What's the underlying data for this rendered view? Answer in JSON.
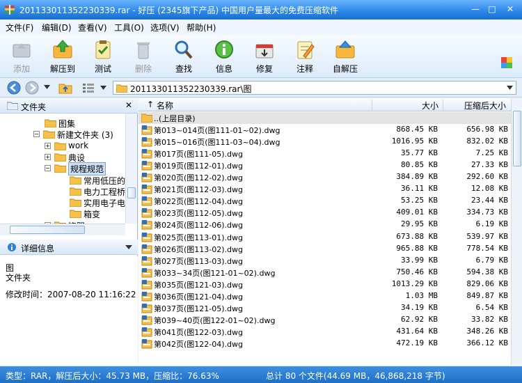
{
  "window": {
    "title": "201133011352230339.rar - 好压 (2345旗下产品) 中国用户量最大的免费压缩软件",
    "min": "—",
    "max": "□",
    "close": "✕"
  },
  "menu": [
    "文件(F)",
    "编辑(D)",
    "查看(V)",
    "工具(O)",
    "选项(V)",
    "帮助(H)"
  ],
  "toolbar": [
    {
      "label": "添加",
      "icon": "add-icon",
      "enabled": false
    },
    {
      "label": "解压到",
      "icon": "extract-icon",
      "enabled": true
    },
    {
      "label": "测试",
      "icon": "test-icon",
      "enabled": true
    },
    {
      "label": "删除",
      "icon": "delete-icon",
      "enabled": false
    },
    {
      "label": "查找",
      "icon": "find-icon",
      "enabled": true
    },
    {
      "label": "信息",
      "icon": "info-icon",
      "enabled": true
    },
    {
      "label": "修复",
      "icon": "repair-icon",
      "enabled": true
    },
    {
      "label": "注释",
      "icon": "comment-icon",
      "enabled": true
    },
    {
      "label": "自解压",
      "icon": "sfx-icon",
      "enabled": true
    }
  ],
  "address": {
    "path": "201133011352230339.rar\\图"
  },
  "folder_pane": {
    "title": "文件夹",
    "close": "✕",
    "tree": [
      {
        "label": "图集",
        "level": 2,
        "expander": ""
      },
      {
        "label": "新建文件夹 (3)",
        "level": 1,
        "expander": "−"
      },
      {
        "label": "work",
        "level": 2,
        "expander": "+"
      },
      {
        "label": "典设",
        "level": 2,
        "expander": "+"
      },
      {
        "label": "规程规范",
        "level": 2,
        "expander": "−",
        "selected": true
      },
      {
        "label": "常用低压的",
        "level": 3,
        "expander": ""
      },
      {
        "label": "电力工程桥",
        "level": 3,
        "expander": ""
      },
      {
        "label": "实用电子电",
        "level": 3,
        "expander": ""
      },
      {
        "label": "箱变",
        "level": 3,
        "expander": ""
      },
      {
        "label": "饶阳",
        "level": 2,
        "expander": "+"
      }
    ]
  },
  "details_pane": {
    "title": "详细信息",
    "name": "图",
    "type": "文件夹",
    "modified": "修改时间：2007-08-20 11:16:22"
  },
  "columns": {
    "name": "名称",
    "size": "大小",
    "csize": "压缩后大小"
  },
  "files": [
    {
      "name": "..(上层目录)",
      "size": "",
      "csize": "",
      "parent": true
    },
    {
      "name": "第013~014页(图111-01~02).dwg",
      "size": "868.45 KB",
      "csize": "656.98 KB"
    },
    {
      "name": "第015~016页(图111-03~04).dwg",
      "size": "1016.95 KB",
      "csize": "832.02 KB"
    },
    {
      "name": "第017页(图111-05).dwg",
      "size": "35.77 KB",
      "csize": "7.25 KB"
    },
    {
      "name": "第019页(图112-01).dwg",
      "size": "80.85 KB",
      "csize": "27.33 KB"
    },
    {
      "name": "第020页(图112-02).dwg",
      "size": "384.89 KB",
      "csize": "292.60 KB"
    },
    {
      "name": "第021页(图112-03).dwg",
      "size": "36.11 KB",
      "csize": "12.08 KB"
    },
    {
      "name": "第022页(图112-04).dwg",
      "size": "53.25 KB",
      "csize": "23.44 KB"
    },
    {
      "name": "第023页(图112-05).dwg",
      "size": "409.01 KB",
      "csize": "334.73 KB"
    },
    {
      "name": "第024页(图112-06).dwg",
      "size": "29.95 KB",
      "csize": "6.19 KB"
    },
    {
      "name": "第025页(图113-01).dwg",
      "size": "673.88 KB",
      "csize": "539.97 KB"
    },
    {
      "name": "第026页(图113-02).dwg",
      "size": "965.88 KB",
      "csize": "778.54 KB"
    },
    {
      "name": "第027页(图113-03).dwg",
      "size": "33.99 KB",
      "csize": "6.79 KB"
    },
    {
      "name": "第033~34页(图121-01~02).dwg",
      "size": "750.46 KB",
      "csize": "594.38 KB"
    },
    {
      "name": "第035页(图121-03).dwg",
      "size": "1013.29 KB",
      "csize": "829.06 KB"
    },
    {
      "name": "第036页(图121-04).dwg",
      "size": "1.03 MB",
      "csize": "849.87 KB"
    },
    {
      "name": "第037页(图121-05).dwg",
      "size": "34.19 KB",
      "csize": "6.54 KB"
    },
    {
      "name": "第039~40页(图122-01~02).dwg",
      "size": "62.92 KB",
      "csize": "33.82 KB"
    },
    {
      "name": "第041页(图122-03).dwg",
      "size": "431.64 KB",
      "csize": "348.26 KB"
    },
    {
      "name": "第042页(图122-04).dwg",
      "size": "472.19 KB",
      "csize": "366.12 KB"
    }
  ],
  "status": {
    "left": "类型：RAR，解压后大小：45.73 MB，压缩比：76.63%",
    "right": "总计 80 个文件(44.69 MB，46,868,218 字节)"
  }
}
